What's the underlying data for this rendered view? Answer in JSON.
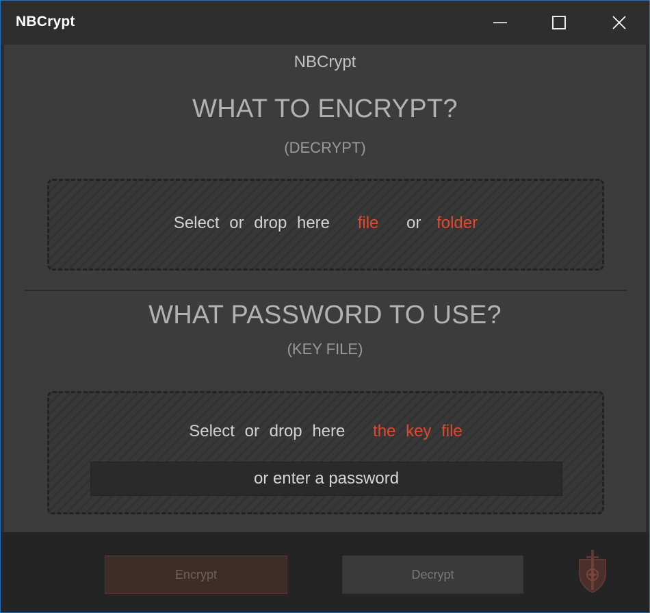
{
  "window": {
    "title": "NBCrypt"
  },
  "header": {
    "app_name": "NBCrypt"
  },
  "encrypt_section": {
    "title": "WHAT TO ENCRYPT?",
    "subtitle": "(DECRYPT)",
    "dropzone": {
      "prefix": "Select or drop here",
      "file_link": "file",
      "or": "or",
      "folder_link": "folder"
    }
  },
  "password_section": {
    "title": "WHAT PASSWORD TO USE?",
    "subtitle": "(KEY FILE)",
    "dropzone": {
      "prefix": "Select or drop here",
      "key_link": "the key file"
    },
    "password_input": {
      "placeholder": "or enter a password",
      "value": ""
    }
  },
  "footer": {
    "encrypt_label": "Encrypt",
    "decrypt_label": "Decrypt"
  },
  "icons": {
    "minimize": "minimize-icon",
    "maximize": "maximize-icon",
    "close": "close-icon",
    "logo": "shield-sword-logo"
  },
  "colors": {
    "accent": "#e24a2e",
    "background": "#3c3c3c",
    "titlebar": "#2e2e2e",
    "footer": "#242424"
  }
}
